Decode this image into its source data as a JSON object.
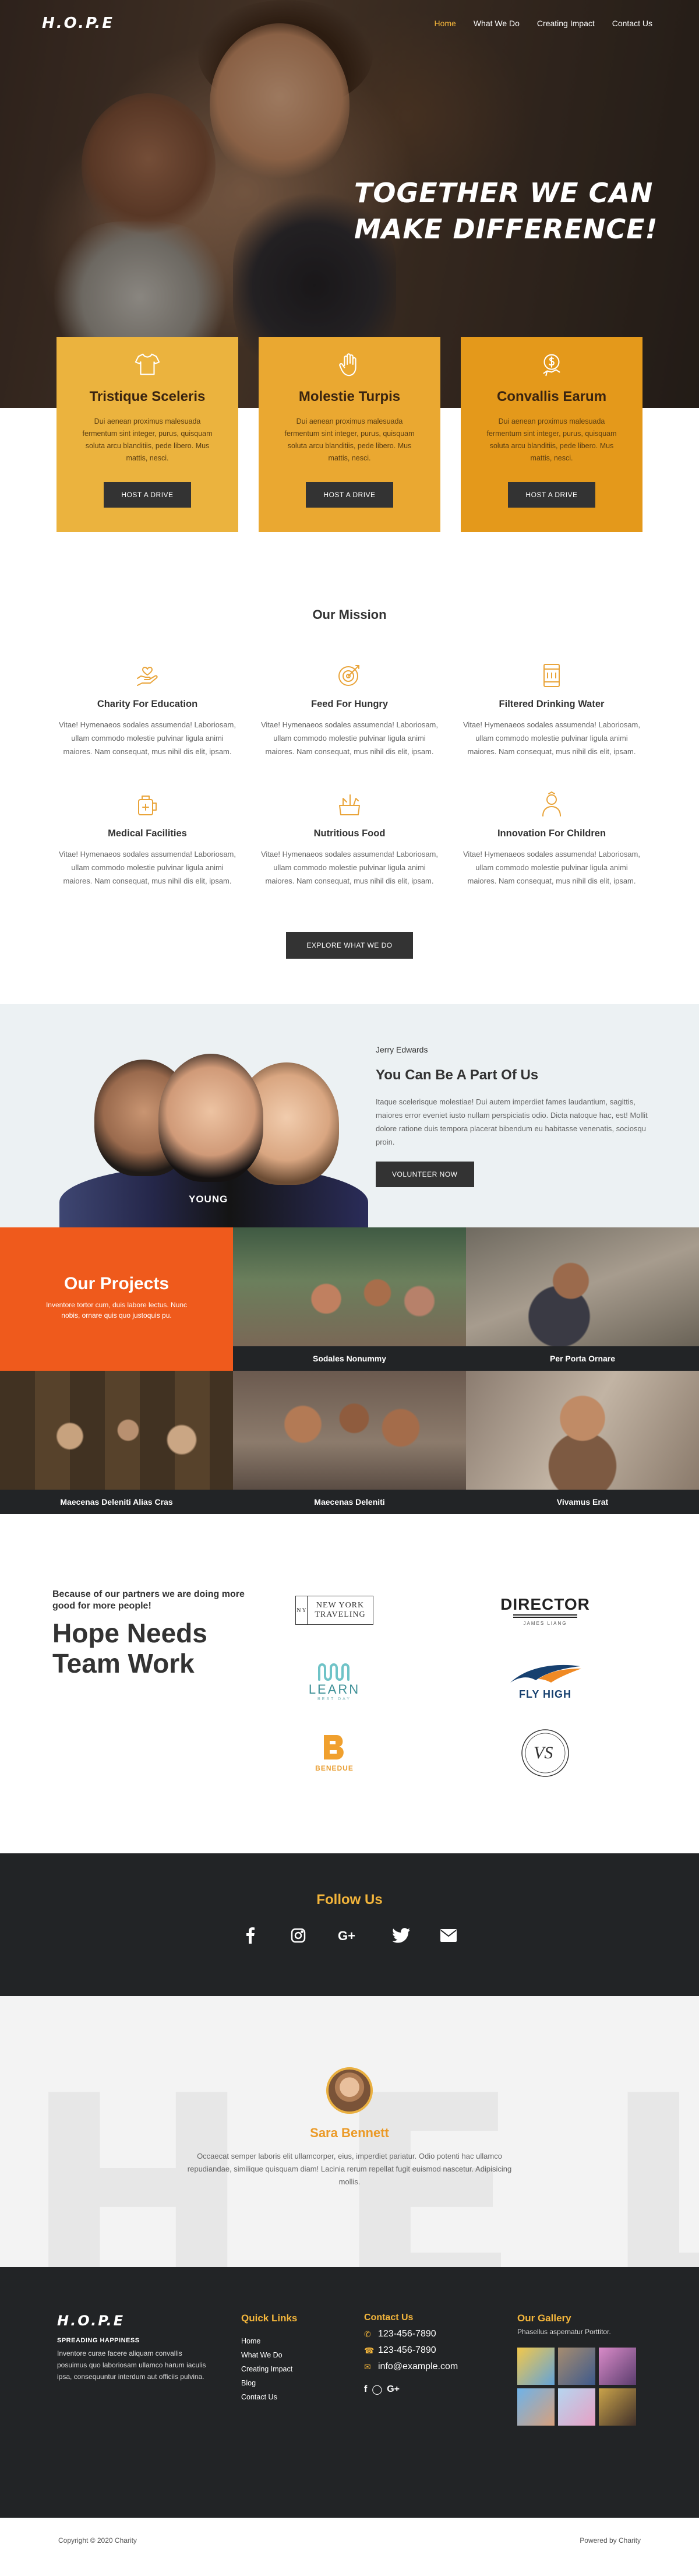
{
  "nav": {
    "logo": "H.O.P.E",
    "links": [
      "Home",
      "What We Do",
      "Creating Impact",
      "Contact Us"
    ]
  },
  "hero": {
    "title_line1": "Together we can",
    "title_line2": "make difference!"
  },
  "cards": [
    {
      "icon": "tshirt-icon",
      "title": "Tristique Sceleris",
      "text": "Dui aenean proximus malesuada fermentum sint integer, purus, quisquam soluta arcu blanditiis, pede libero. Mus mattis, nesci.",
      "button": "Host a Drive"
    },
    {
      "icon": "hand-icon",
      "title": "Molestie Turpis",
      "text": "Dui aenean proximus malesuada fermentum sint integer, purus, quisquam soluta arcu blanditiis, pede libero. Mus mattis, nesci.",
      "button": "Host a Drive"
    },
    {
      "icon": "coin-hand-icon",
      "title": "Convallis Earum",
      "text": "Dui aenean proximus malesuada fermentum sint integer, purus, quisquam soluta arcu blanditiis, pede libero. Mus mattis, nesci.",
      "button": "Host a Drive"
    }
  ],
  "mission": {
    "title": "Our Mission",
    "items": [
      {
        "icon": "donate-hand-icon",
        "title": "Charity For Education",
        "text": "Vitae! Hymenaeos sodales assumenda! Laboriosam, ullam commodo molestie pulvinar ligula animi maiores. Nam consequat, mus nihil dis elit, ipsam."
      },
      {
        "icon": "target-icon",
        "title": "Feed For Hungry",
        "text": "Vitae! Hymenaeos sodales assumenda! Laboriosam, ullam commodo molestie pulvinar ligula animi maiores. Nam consequat, mus nihil dis elit, ipsam."
      },
      {
        "icon": "filter-icon",
        "title": "Filtered Drinking Water",
        "text": "Vitae! Hymenaeos sodales assumenda! Laboriosam, ullam commodo molestie pulvinar ligula animi maiores. Nam consequat, mus nihil dis elit, ipsam."
      },
      {
        "icon": "medical-bag-icon",
        "title": "Medical Facilities",
        "text": "Vitae! Hymenaeos sodales assumenda! Laboriosam, ullam commodo molestie pulvinar ligula animi maiores. Nam consequat, mus nihil dis elit, ipsam."
      },
      {
        "icon": "food-box-icon",
        "title": "Nutritious Food",
        "text": "Vitae! Hymenaeos sodales assumenda! Laboriosam, ullam commodo molestie pulvinar ligula animi maiores. Nam consequat, mus nihil dis elit, ipsam."
      },
      {
        "icon": "child-icon",
        "title": "Innovation For Children",
        "text": "Vitae! Hymenaeos sodales assumenda! Laboriosam, ullam commodo molestie pulvinar ligula animi maiores. Nam consequat, mus nihil dis elit, ipsam."
      }
    ],
    "button": "Explore What We Do"
  },
  "partof": {
    "name": "Jerry Edwards",
    "title": "You Can Be A Part Of Us",
    "text": "Itaque scelerisque molestiae! Dui autem imperdiet fames laudantium, sagittis, maiores error eveniet iusto nullam perspiciatis odio. Dicta natoque hac, est! Mollit dolore ratione duis tempora placerat bibendum eu habitasse venenatis, sociosqu proin.",
    "button": "Volunteer Now",
    "tee_text": "YOUNG"
  },
  "projects": {
    "title": "Our Projects",
    "subtitle": "Inventore tortor cum, duis labore lectus. Nunc nobis, ornare quis quo justoquis pu.",
    "items": [
      "Sodales Nonummy",
      "Per Porta Ornare",
      "Maecenas Deleniti Alias Cras",
      "Maecenas Deleniti",
      "Vivamus Erat"
    ]
  },
  "partners": {
    "lead": "Because of our partners we are doing more good for more people!",
    "title": "Hope Needs Team Work",
    "logos": {
      "ny_left": "N Y",
      "ny_line1": "NEW YORK",
      "ny_line2": "TRAVELING",
      "director": "DIRECTOR",
      "director_sub": "JAMES LIANG",
      "learn": "LEARN",
      "learn_sub": "BEST DAY",
      "fly": "FLY HIGH",
      "ben": "BENEDUE",
      "vs": "VS"
    }
  },
  "follow": {
    "title": "Follow Us",
    "icons": [
      "facebook-icon",
      "instagram-icon",
      "google-plus-icon",
      "twitter-icon",
      "mail-icon"
    ]
  },
  "testimonial": {
    "watermark": "HEL",
    "name": "Sara Bennett",
    "text": "Occaecat semper laboris elit ullamcorper, eius, imperdiet pariatur. Odio potenti hac ullamco repudiandae, similique quisquam diam! Lacinia rerum repellat fugit euismod nascetur. Adipisicing mollis."
  },
  "footer": {
    "logo": "H.O.P.E",
    "tagline": "SPREADING HAPPINESS",
    "about": "Inventore curae facere aliquam convallis posuimus quo laboriosam ullamco harum iaculis ipsa, consequuntur interdum aut officiis pulvina.",
    "quick_title": "Quick Links",
    "quick_links": [
      "Home",
      "What We Do",
      "Creating Impact",
      "Blog",
      "Contact Us"
    ],
    "contact_title": "Contact Us",
    "phone1": "123-456-7890",
    "phone2": "123-456-7890",
    "email": "info@example.com",
    "gallery_title": "Our Gallery",
    "gallery_sub": "Phasellus aspernatur Porttitor."
  },
  "bottom": {
    "copyright": "Copyright © 2020 Charity",
    "powered": "Powered by Charity"
  },
  "colors": {
    "accent": "#f3b53b",
    "orange": "#ef5a1c",
    "dark": "#222426"
  }
}
